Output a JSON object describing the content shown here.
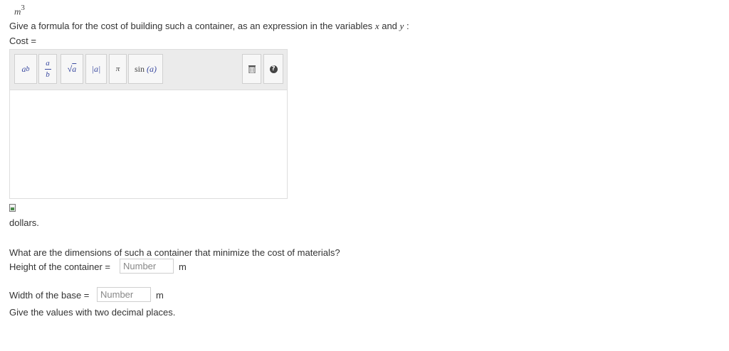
{
  "previous_unit": {
    "base": "m",
    "exponent": "3"
  },
  "formula_prompt": {
    "text": "Give a formula for the cost of building such a container, as an expression in the variables",
    "var_x": "x",
    "and": "and",
    "var_y": "y",
    "colon": ":"
  },
  "cost_label": "Cost =",
  "toolbar": {
    "power": {
      "base": "a",
      "exp": "b"
    },
    "fraction": {
      "num": "a",
      "den": "b"
    },
    "sqrt": {
      "symbol": "√",
      "arg": "a"
    },
    "abs": "|a|",
    "pi": "π",
    "sin": {
      "fn": "sin",
      "arg": "(a)"
    },
    "delete_icon": "trash-icon",
    "help_icon": "question-icon",
    "help_glyph": "?"
  },
  "units_after_cost": "dollars.",
  "question2": "What are the dimensions of such a container that minimize the cost of materials?",
  "height": {
    "label": "Height of the container =",
    "placeholder": "Number",
    "value": "",
    "unit": "m"
  },
  "width": {
    "label": "Width of the base =",
    "placeholder": "Number",
    "value": "",
    "unit": "m"
  },
  "footer_note": "Give the values with two decimal places."
}
